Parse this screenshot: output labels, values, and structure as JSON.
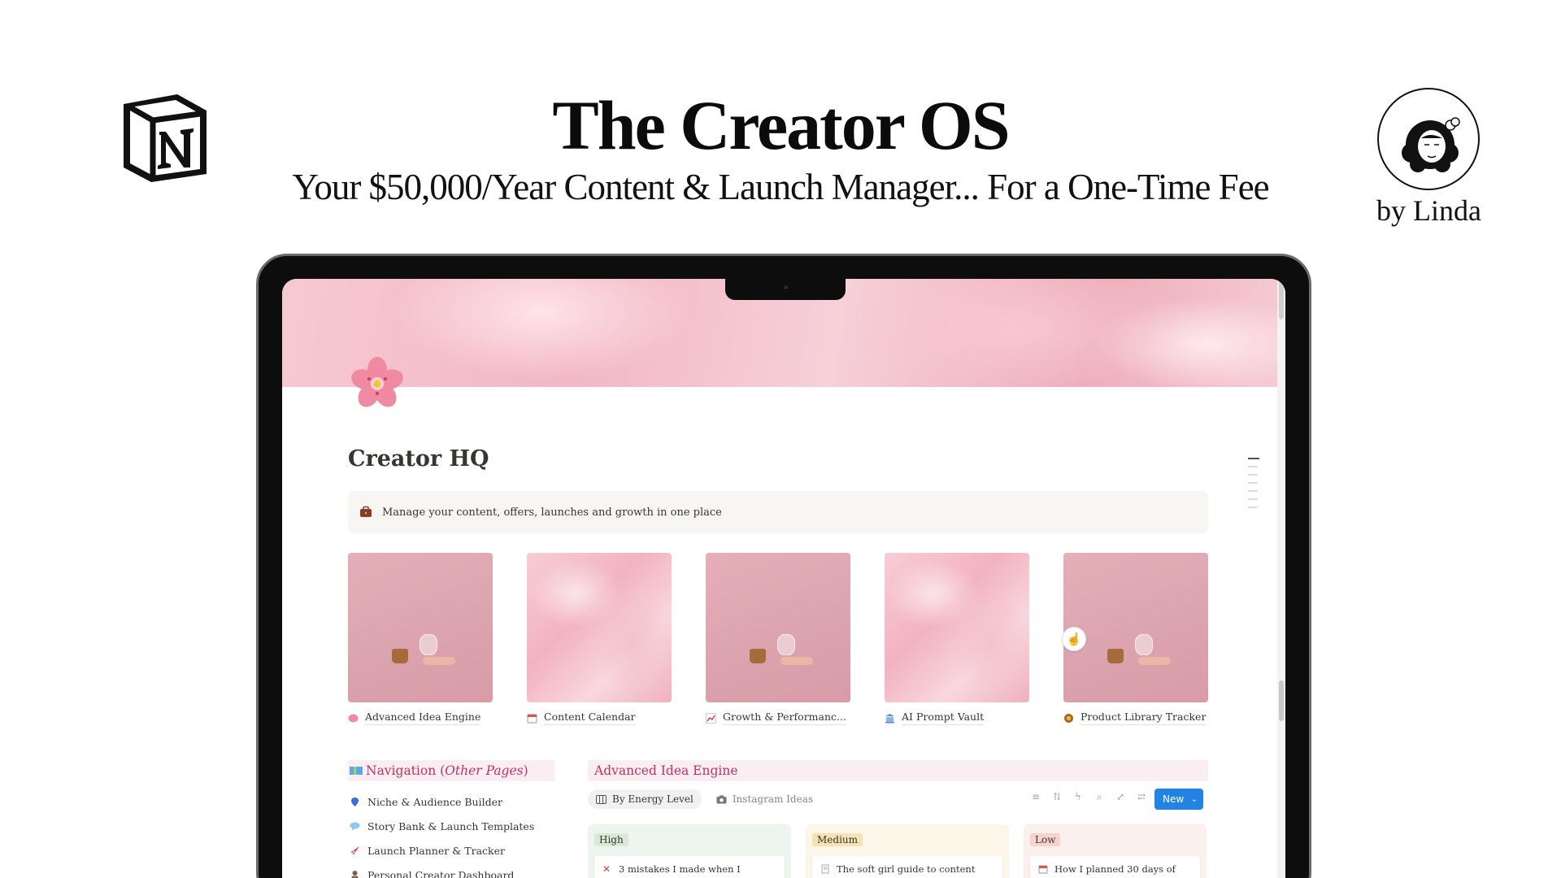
{
  "header": {
    "title": "The Creator OS",
    "subtitle": "Your $50,000/Year Content & Launch Manager... For a One-Time Fee",
    "byline": "by Linda"
  },
  "page": {
    "title": "Creator HQ",
    "callout": "Manage your content, offers, launches and growth in one place"
  },
  "gallery": [
    {
      "label": "Advanced Idea Engine",
      "icon": "brain-icon"
    },
    {
      "label": "Content Calendar",
      "icon": "calendar-icon"
    },
    {
      "label": "Growth & Performanc...",
      "icon": "chart-icon"
    },
    {
      "label": "AI Prompt Vault",
      "icon": "bank-icon"
    },
    {
      "label": "Product Library Tracker",
      "icon": "box-icon"
    }
  ],
  "navigation": {
    "title_main": "Navigation (",
    "title_italic": "Other Pages",
    "title_end": ")",
    "items": [
      {
        "label": "Niche & Audience Builder",
        "icon": "map-pin-icon"
      },
      {
        "label": "Story Bank & Launch Templates",
        "icon": "speech-icon"
      },
      {
        "label": "Launch Planner & Tracker",
        "icon": "rocket-icon"
      },
      {
        "label": "Personal Creator Dashboard",
        "icon": "person-icon"
      }
    ]
  },
  "idea_engine": {
    "title": "Advanced Idea Engine",
    "views": [
      {
        "label": "By Energy Level",
        "active": true
      },
      {
        "label": "Instagram Ideas",
        "active": false
      }
    ],
    "new_label": "New",
    "columns": [
      {
        "tag": "High",
        "card": "3 mistakes I made when I"
      },
      {
        "tag": "Medium",
        "card": "The soft girl guide to content"
      },
      {
        "tag": "Low",
        "card": "How I planned 30 days of"
      }
    ]
  },
  "colors": {
    "accent_pink": "#c4305f",
    "new_button": "#2383e2"
  }
}
